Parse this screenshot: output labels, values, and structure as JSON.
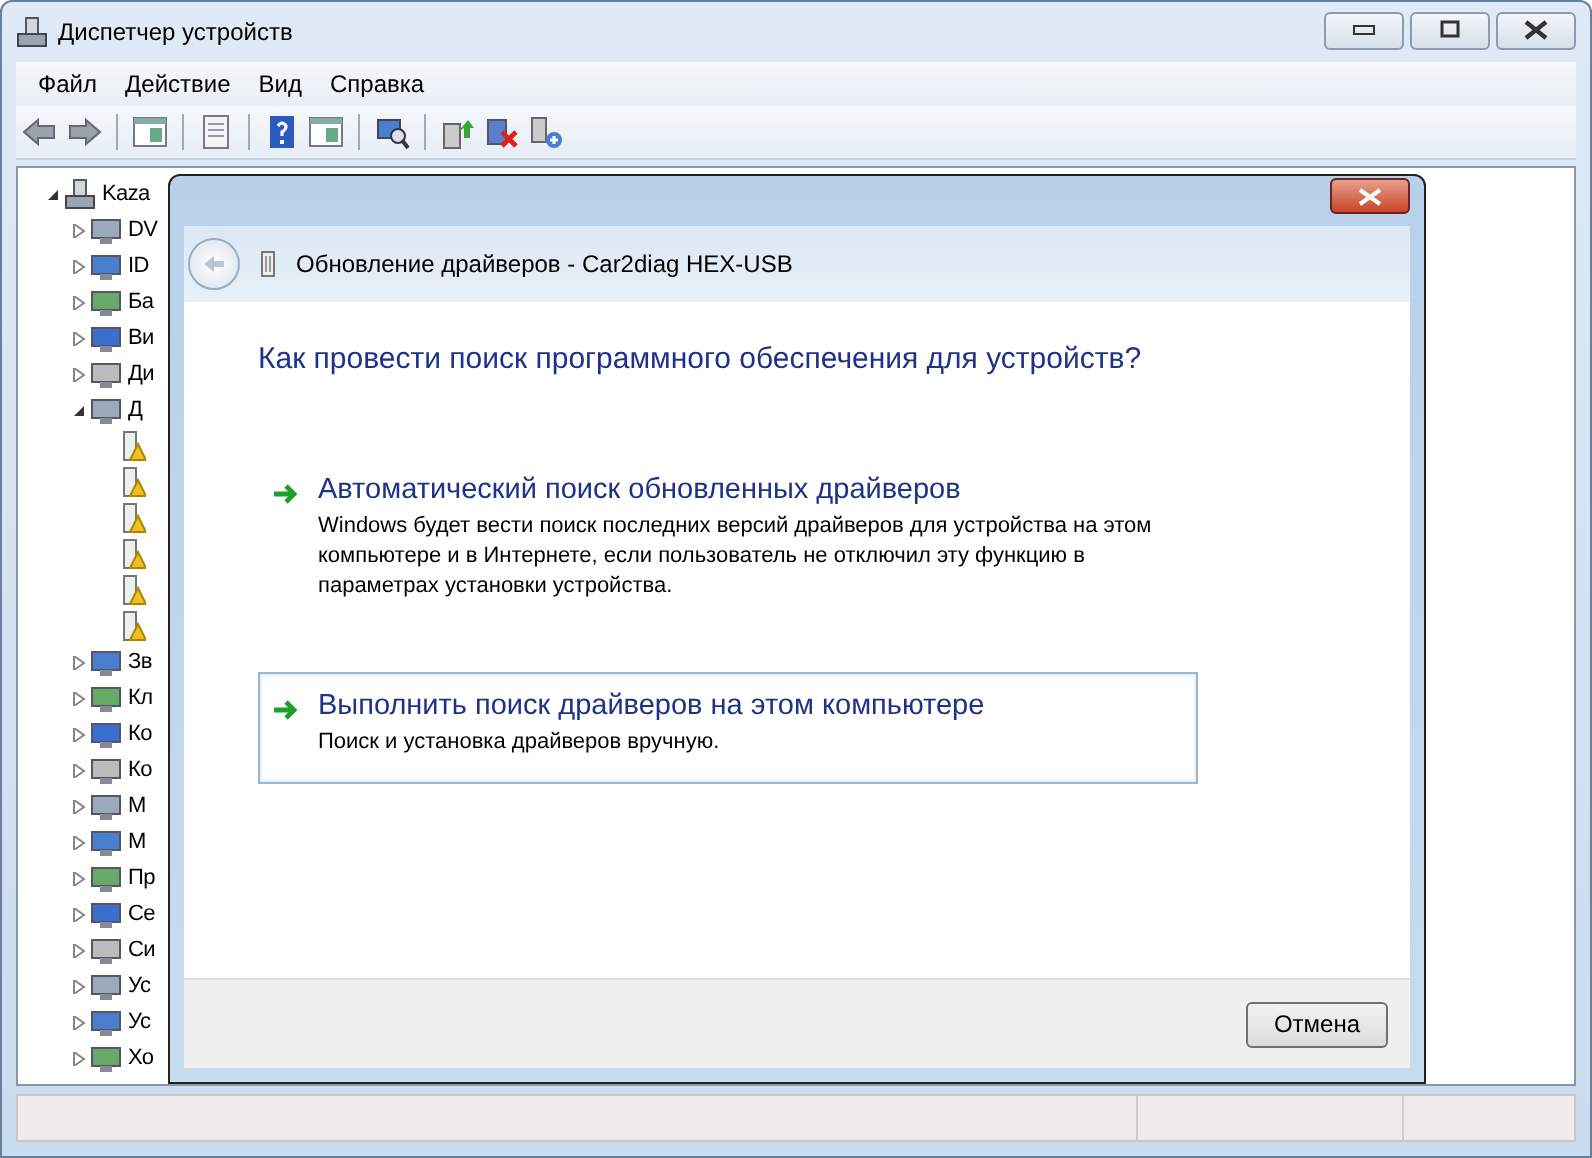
{
  "window": {
    "title": "Диспетчер устройств"
  },
  "menu": [
    "Файл",
    "Действие",
    "Вид",
    "Справка"
  ],
  "tree": {
    "label": "Kaza",
    "expanded": true,
    "children": [
      {
        "label": "DV",
        "expanded": false
      },
      {
        "label": "ID",
        "expanded": false
      },
      {
        "label": "Ба",
        "expanded": false
      },
      {
        "label": "Ви",
        "expanded": false
      },
      {
        "label": "Ди",
        "expanded": false
      },
      {
        "label": "Д",
        "expanded": true,
        "children": [
          {
            "warning": true
          },
          {
            "warning": true
          },
          {
            "warning": true
          },
          {
            "warning": true
          },
          {
            "warning": true
          },
          {
            "warning": true
          }
        ]
      },
      {
        "label": "Зв",
        "expanded": false
      },
      {
        "label": "Кл",
        "expanded": false
      },
      {
        "label": "Ко",
        "expanded": false
      },
      {
        "label": "Ко",
        "expanded": false
      },
      {
        "label": "М",
        "expanded": false
      },
      {
        "label": "М",
        "expanded": false
      },
      {
        "label": "Пр",
        "expanded": false
      },
      {
        "label": "Се",
        "expanded": false
      },
      {
        "label": "Си",
        "expanded": false
      },
      {
        "label": "Ус",
        "expanded": false
      },
      {
        "label": "Ус",
        "expanded": false
      },
      {
        "label": "Хо",
        "expanded": false
      }
    ]
  },
  "dialog": {
    "title": "Обновление драйверов - Car2diag HEX-USB",
    "question": "Как провести поиск программного обеспечения для устройств?",
    "options": [
      {
        "title": "Автоматический поиск обновленных драйверов",
        "description": "Windows будет вести поиск последних версий драйверов для устройства на этом компьютере и в Интернете, если пользователь не отключил эту функцию в параметрах установки устройства.",
        "selected": false
      },
      {
        "title": "Выполнить поиск драйверов на этом компьютере",
        "description": "Поиск и установка драйверов вручную.",
        "selected": true
      }
    ],
    "buttons": [
      "Отмена"
    ]
  }
}
